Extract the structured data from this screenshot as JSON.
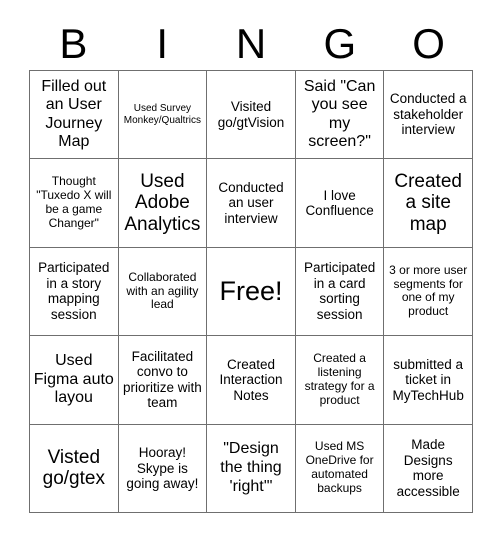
{
  "header": {
    "letters": [
      "B",
      "I",
      "N",
      "G",
      "O"
    ]
  },
  "grid": {
    "rows": 5,
    "columns": 5,
    "cells": [
      {
        "text": "Filled out an User Journey Map",
        "size": "l"
      },
      {
        "text": "Used Survey Monkey/Qualtrics",
        "size": "xs"
      },
      {
        "text": "Visited go/gtVision",
        "size": "m"
      },
      {
        "text": "Said \"Can you see my screen?\"",
        "size": "l"
      },
      {
        "text": "Conducted a stakeholder interview",
        "size": "m"
      },
      {
        "text": "Thought \"Tuxedo X will be a game Changer\"",
        "size": "s"
      },
      {
        "text": "Used Adobe Analytics",
        "size": "xl"
      },
      {
        "text": "Conducted an user interview",
        "size": "m"
      },
      {
        "text": "I love Confluence",
        "size": "m"
      },
      {
        "text": "Created a site map",
        "size": "xl"
      },
      {
        "text": "Participated in a story mapping session",
        "size": "m"
      },
      {
        "text": "Collaborated with an agility lead",
        "size": "s"
      },
      {
        "text": "Free!",
        "size": "xxl"
      },
      {
        "text": "Participated in a card sorting session",
        "size": "m"
      },
      {
        "text": "3 or more user segments for one of my product",
        "size": "s"
      },
      {
        "text": "Used Figma auto layou",
        "size": "l"
      },
      {
        "text": "Facilitated convo to prioritize with team",
        "size": "m"
      },
      {
        "text": "Created Interaction Notes",
        "size": "m"
      },
      {
        "text": "Created a listening strategy for a product",
        "size": "s"
      },
      {
        "text": "submitted a ticket in MyTechHub",
        "size": "m"
      },
      {
        "text": "Visted go/gtex",
        "size": "xl"
      },
      {
        "text": "Hooray! Skype is going away!",
        "size": "m"
      },
      {
        "text": "\"Design the thing 'right'\"",
        "size": "l"
      },
      {
        "text": "Used MS OneDrive for automated backups",
        "size": "s"
      },
      {
        "text": "Made Designs more accessible",
        "size": "m"
      }
    ]
  },
  "colors": {
    "background": "#ffffff",
    "text": "#000000",
    "grid_line": "#6f6f6f"
  }
}
